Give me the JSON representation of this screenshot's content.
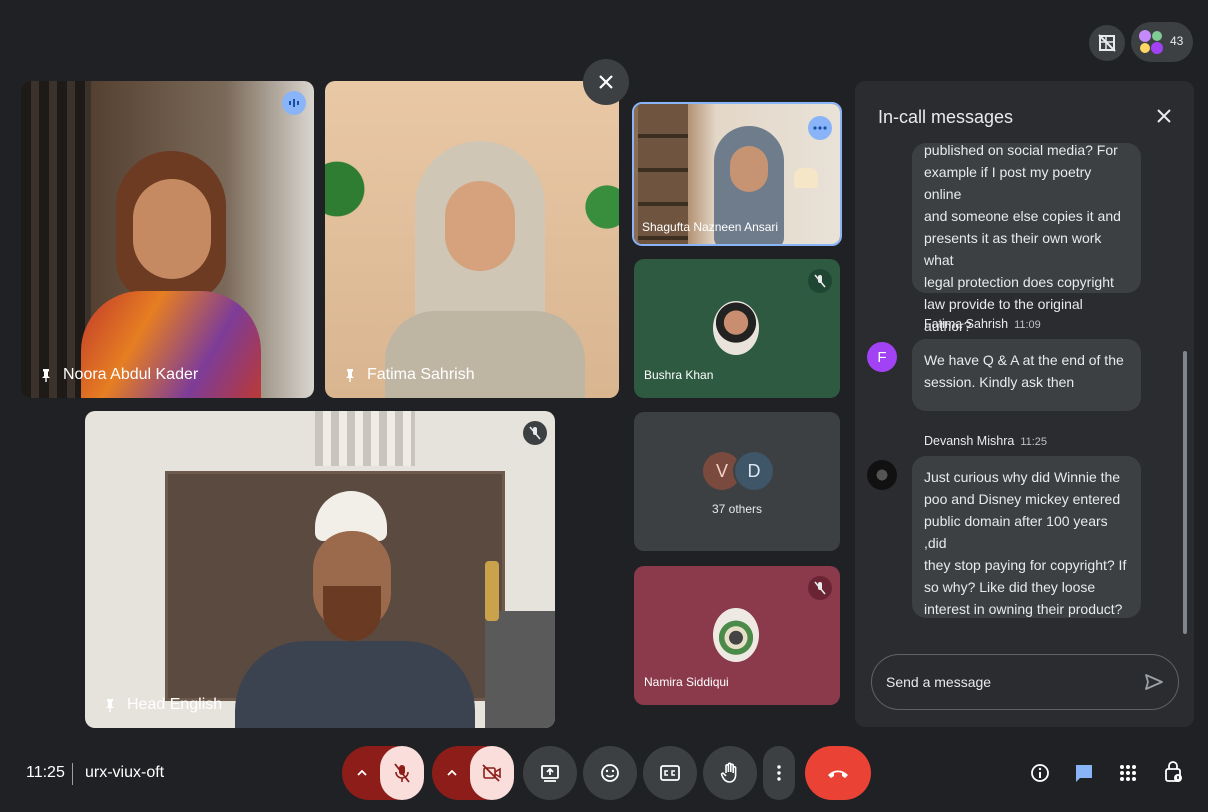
{
  "top": {
    "participant_count": "43"
  },
  "tiles": {
    "noora": {
      "name": "Noora Abdul Kader"
    },
    "fatima": {
      "name": "Fatima Sahrish"
    },
    "head": {
      "name": "Head English"
    },
    "shagufta": {
      "name": "Shagufta Nazneen Ansari"
    },
    "bushra": {
      "name": "Bushra Khan"
    },
    "others": {
      "avatar1": "V",
      "avatar2": "D",
      "label": "37 others"
    },
    "namira": {
      "name": "Namira Siddiqui"
    }
  },
  "panel": {
    "title": "In-call messages",
    "messages": [
      {
        "text_lines": [
          "published on social media? For",
          "example if I post my poetry online",
          "and someone else copies it and",
          "presents it as their own work what",
          "legal protection does copyright",
          "law provide to the original author?"
        ]
      },
      {
        "sender": "Fatima Sahrish",
        "time": "11:09",
        "avatar": "F",
        "text_lines": [
          "We have Q & A at the end of the",
          "session. Kindly ask then"
        ]
      },
      {
        "sender": "Devansh Mishra",
        "time": "11:25",
        "text_lines": [
          "Just curious why did Winnie the",
          "poo and Disney mickey entered",
          "public domain after 100 years ,did",
          "they stop paying for copyright? If",
          "so why? Like did they loose",
          "interest in owning their product?"
        ]
      }
    ],
    "input_placeholder": "Send a message"
  },
  "bottom": {
    "time": "11:25",
    "meeting_code": "urx-viux-oft"
  },
  "colors": {
    "end_call": "#ea4335",
    "muted_bg": "#f9dedc",
    "muted_dark": "#8c1d18",
    "accent": "#8ab4f8"
  }
}
